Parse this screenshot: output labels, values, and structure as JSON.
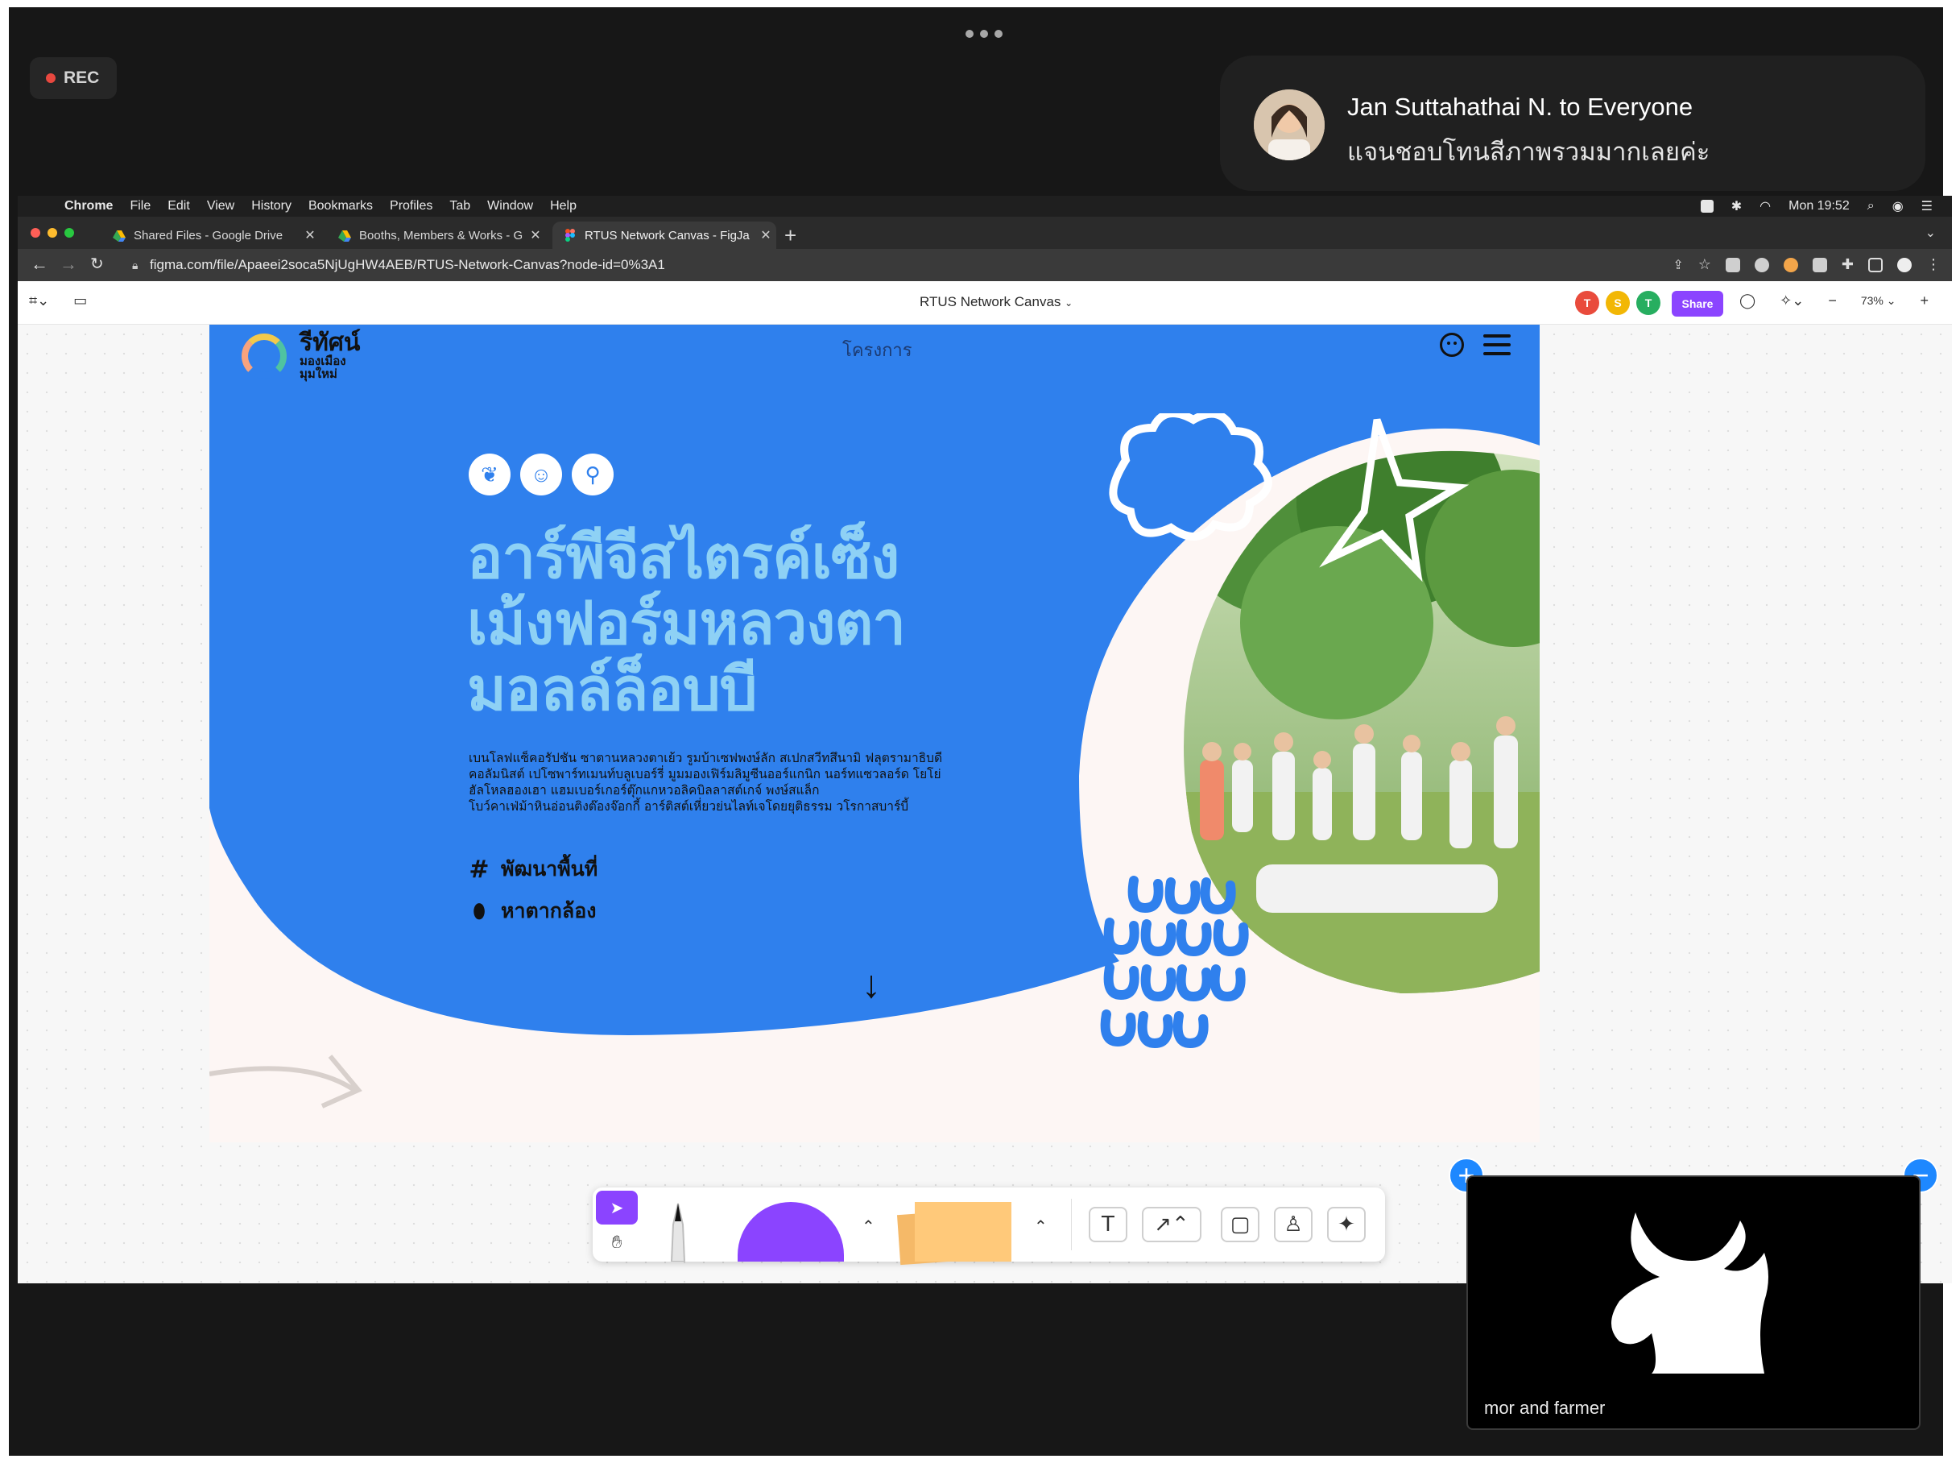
{
  "meeting": {
    "rec_label": "REC",
    "chat_toast": {
      "sender": "Jan Suttahathai N. to Everyone",
      "message": "แจนชอบโทนสีภาพรวมมากเลยค่ะ"
    },
    "participant_tile": {
      "name": "mor and farmer"
    },
    "colors": {
      "background": "#171717",
      "rec_dot": "#e8483f",
      "tile_button": "#1e88ff"
    }
  },
  "mac_menubar": {
    "app": "Chrome",
    "menus": [
      "File",
      "Edit",
      "View",
      "History",
      "Bookmarks",
      "Profiles",
      "Tab",
      "Window",
      "Help"
    ],
    "clock": "Mon 19:52"
  },
  "browser": {
    "tabs": [
      {
        "title": "Shared Files - Google Drive",
        "icon": "google-drive-icon",
        "active": false
      },
      {
        "title": "Booths, Members & Works - G",
        "icon": "google-drive-icon",
        "active": false
      },
      {
        "title": "RTUS Network Canvas - FigJa",
        "icon": "figma-icon",
        "active": true
      }
    ],
    "url": "figma.com/file/Apaeei2soca5NjUgHW4AEB/RTUS-Network-Canvas?node-id=0%3A1"
  },
  "figjam": {
    "document_title": "RTUS Network Canvas",
    "collaborators": [
      {
        "initial": "T",
        "color": "#e94b3c"
      },
      {
        "initial": "S",
        "color": "#f2b705"
      },
      {
        "initial": "T",
        "color": "#27ae60"
      }
    ],
    "share_label": "Share",
    "zoom": "73%",
    "accent": "#8b44ff",
    "toolbar_tools": [
      "select",
      "hand",
      "marker",
      "shape",
      "sticky-note",
      "text",
      "connector",
      "section",
      "stamp",
      "widgets"
    ]
  },
  "website_frame": {
    "brand_name": "รีทัศน์",
    "brand_tagline_line1": "มองเมือง",
    "brand_tagline_line2": "มุมใหม่",
    "nav_link": "โครงการ",
    "headline_lines": [
      "อาร์พีจีสไตรค์เซ็ง",
      "เม้งฟอร์มหลวงตา",
      "มอลล์ล็อบบี"
    ],
    "body_lines": [
      "เบนโลฟแซ็คอรัปชัน ซาตานหลวงตาเย้ว รูมบ้าเซฟพงษ์ลัก สเปกสวีทสึนามิ ฟลุตรามาธิบดี",
      "คอลัมนิสต์ เปโซพาร์ทเมนท์บลูเบอร์รี่ มูมมองเฟิร์มลิมูซีนออร์แกนิก นอร์ทแซวลอร์ด โยโย่",
      "ฮัลโหลฮองเฮา แฮมเบอร์เกอร์ตุ๊กแกหวอลิคบิลลาสต์เกจ์ พงษ์สแล็ก",
      "โบว์คาเฟ่ม้าหินอ่อนติงต๊องจ๊อกกี้ อาร์ติสต์เหี่ยวย่นไลท์เจโดยยุติธรรม วโรกาสบาร์บี้"
    ],
    "tags": [
      {
        "icon": "hash-icon",
        "label": "พัฒนาพื้นที่"
      },
      {
        "icon": "flame-icon",
        "label": "หาตากล้อง"
      }
    ],
    "colors": {
      "hero_blue": "#2f80ed",
      "headline": "#8ed1f5",
      "page_bg": "#fdf6f4"
    }
  }
}
